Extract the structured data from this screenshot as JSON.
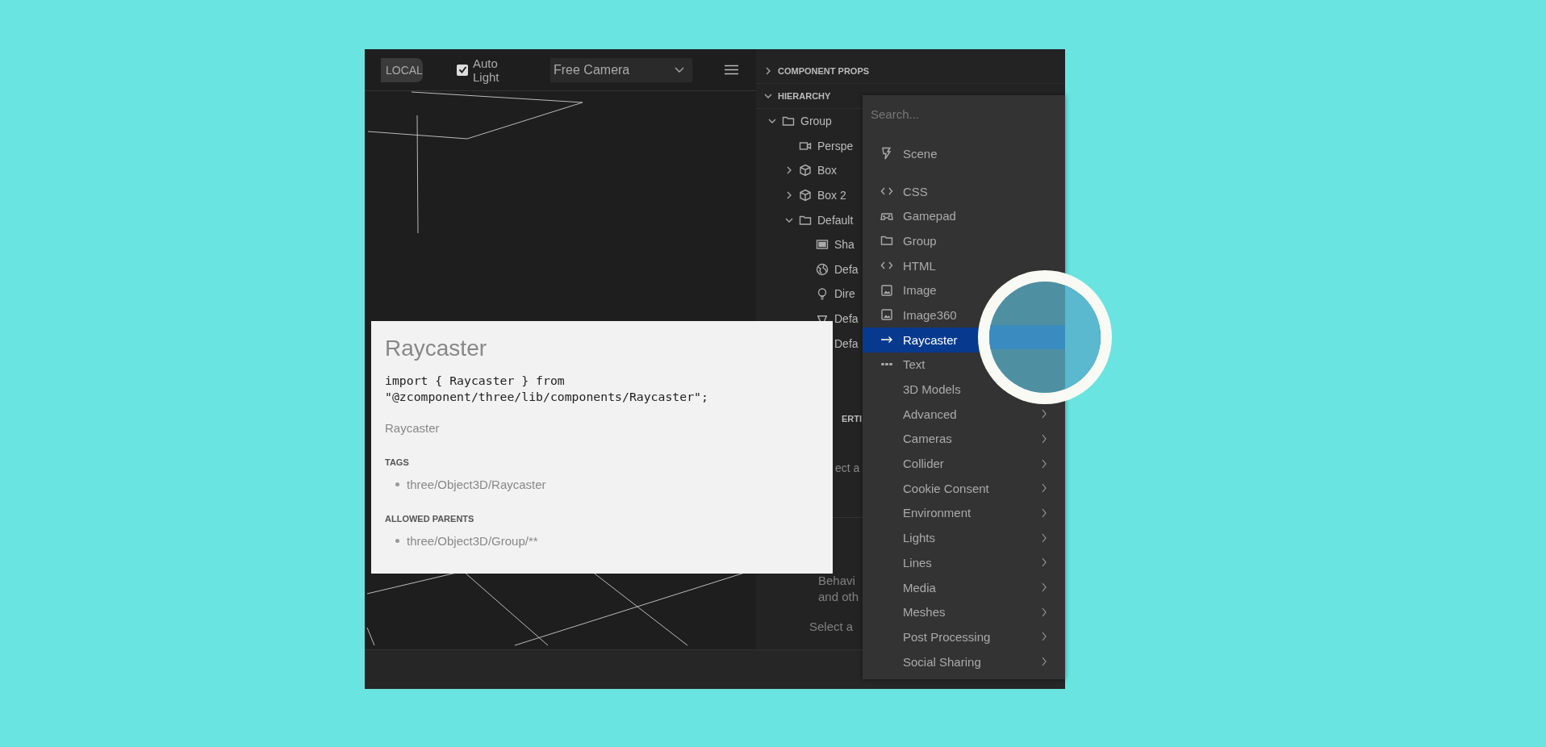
{
  "toolbar": {
    "space_button": "LOCAL",
    "auto_light": {
      "label": "Auto Light",
      "checked": true
    },
    "camera_select": "Free Camera"
  },
  "panel": {
    "sections": [
      {
        "title": "COMPONENT PROPS",
        "expanded": false
      },
      {
        "title": "HIERARCHY",
        "expanded": true
      }
    ],
    "tree": [
      {
        "label": "Group",
        "kind": "folder",
        "expanded": true,
        "children": [
          {
            "label": "Perspe",
            "kind": "camera"
          },
          {
            "label": "Box",
            "kind": "box",
            "expanded": false
          },
          {
            "label": "Box 2",
            "kind": "box",
            "expanded": false
          },
          {
            "label": "Default",
            "kind": "folder",
            "expanded": true,
            "children": [
              {
                "label": "Sha",
                "kind": "screen"
              },
              {
                "label": "Defa",
                "kind": "globe"
              },
              {
                "label": "Dire",
                "kind": "bulb"
              },
              {
                "label": "Defa",
                "kind": "spot"
              },
              {
                "label": "Defa",
                "kind": "none"
              }
            ]
          }
        ]
      }
    ],
    "properties_header": "ERTI",
    "properties_hint": "ect a",
    "behaviors_hint": [
      "Behavi",
      "and oth"
    ],
    "select_hint": "Select a"
  },
  "menu": {
    "search_placeholder": "Search...",
    "scene": "Scene",
    "items": [
      {
        "label": "CSS",
        "kind": "code",
        "selected": false
      },
      {
        "label": "Gamepad",
        "kind": "gamepad",
        "selected": false
      },
      {
        "label": "Group",
        "kind": "folder",
        "selected": false
      },
      {
        "label": "HTML",
        "kind": "code",
        "selected": false
      },
      {
        "label": "Image",
        "kind": "image",
        "selected": false
      },
      {
        "label": "Image360",
        "kind": "image",
        "selected": false
      },
      {
        "label": "Raycaster",
        "kind": "arrow",
        "selected": true
      },
      {
        "label": "Text",
        "kind": "text",
        "selected": false
      },
      {
        "label": "3D Models",
        "kind": "category",
        "selected": false
      },
      {
        "label": "Advanced",
        "kind": "category",
        "selected": false
      },
      {
        "label": "Cameras",
        "kind": "category",
        "selected": false
      },
      {
        "label": "Collider",
        "kind": "category",
        "selected": false
      },
      {
        "label": "Cookie Consent",
        "kind": "category",
        "selected": false
      },
      {
        "label": "Environment",
        "kind": "category",
        "selected": false
      },
      {
        "label": "Lights",
        "kind": "category",
        "selected": false
      },
      {
        "label": "Lines",
        "kind": "category",
        "selected": false
      },
      {
        "label": "Media",
        "kind": "category",
        "selected": false
      },
      {
        "label": "Meshes",
        "kind": "category",
        "selected": false
      },
      {
        "label": "Post Processing",
        "kind": "category",
        "selected": false
      },
      {
        "label": "Social Sharing",
        "kind": "category",
        "selected": false
      }
    ]
  },
  "popup": {
    "title": "Raycaster",
    "code": [
      "import { Raycaster } from",
      "\"@zcomponent/three/lib/components/Raycaster\";"
    ],
    "description": "Raycaster",
    "sections": [
      {
        "heading": "TAGS",
        "items": [
          "three/Object3D/Raycaster"
        ]
      },
      {
        "heading": "ALLOWED PARENTS",
        "items": [
          "three/Object3D/Group/**"
        ]
      }
    ]
  }
}
